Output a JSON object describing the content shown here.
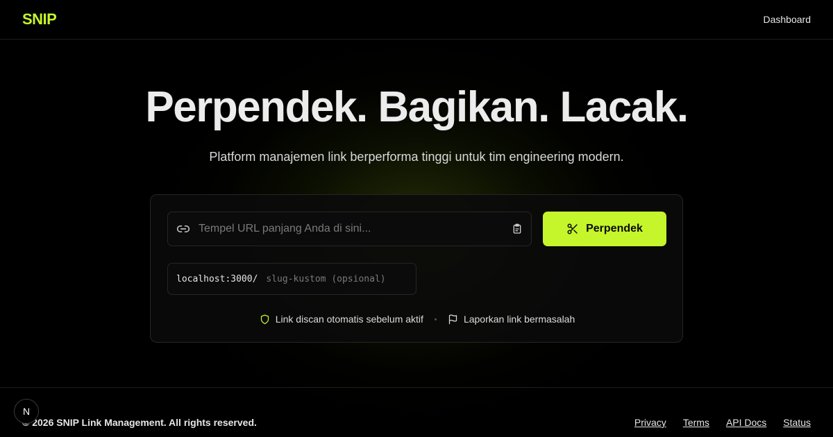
{
  "header": {
    "logo": "SNIP",
    "nav_dashboard": "Dashboard"
  },
  "hero": {
    "title": "Perpendek. Bagikan. Lacak.",
    "subtitle": "Platform manajemen link berperforma tinggi untuk tim engineering modern."
  },
  "form": {
    "url_placeholder": "Tempel URL panjang Anda di sini...",
    "url_value": "",
    "shorten_label": "Perpendek",
    "slug_prefix": "localhost:3000/",
    "slug_placeholder": "slug-kustom (opsional)",
    "slug_value": ""
  },
  "notes": {
    "scan_text": "Link discan otomatis sebelum aktif",
    "report_text": "Laporkan link bermasalah"
  },
  "footer": {
    "copyright": "© 2026 SNIP Link Management. All rights reserved.",
    "links": [
      "Privacy",
      "Terms",
      "API Docs",
      "Status"
    ]
  },
  "devtools": {
    "label": "N"
  },
  "colors": {
    "accent": "#c5f52b",
    "background": "#000000"
  },
  "icons": [
    "link-icon",
    "clipboard-icon",
    "scissors-icon",
    "shield-icon",
    "flag-icon"
  ]
}
